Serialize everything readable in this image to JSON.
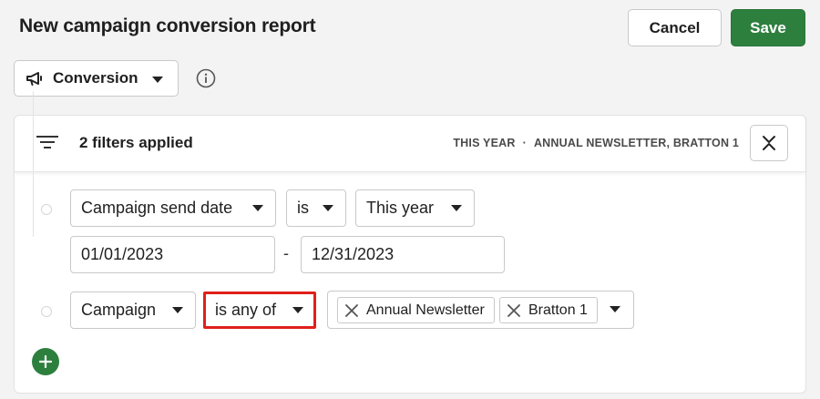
{
  "header": {
    "title": "New campaign conversion report",
    "cancel_label": "Cancel",
    "save_label": "Save"
  },
  "report_type": {
    "label": "Conversion",
    "icon": "megaphone-icon"
  },
  "filters_panel": {
    "count_label": "2 filters applied",
    "summary_period": "THIS YEAR",
    "summary_separator": "·",
    "summary_campaigns": "ANNUAL NEWSLETTER, BRATTON 1"
  },
  "filters": [
    {
      "field": "Campaign send date",
      "operator": "is",
      "value": "This year",
      "date_from": "01/01/2023",
      "date_separator": "-",
      "date_to": "12/31/2023"
    },
    {
      "field": "Campaign",
      "operator": "is any of",
      "selected": [
        "Annual Newsletter",
        "Bratton 1"
      ]
    }
  ],
  "colors": {
    "primary_green": "#2d7f3e",
    "highlight_red": "#e0201b",
    "background": "#f3f3f3"
  }
}
